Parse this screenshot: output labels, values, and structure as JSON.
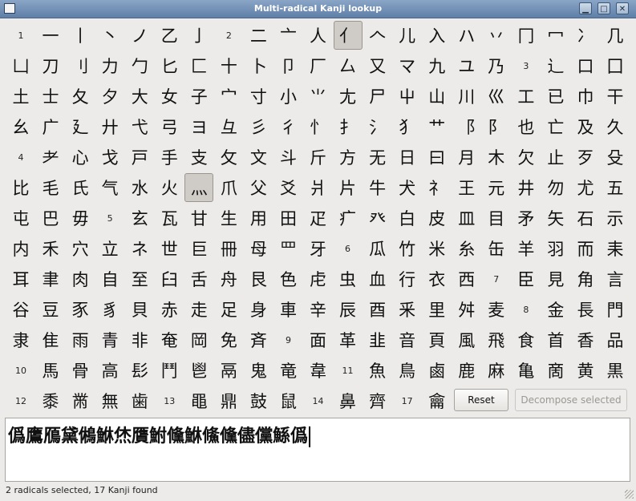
{
  "window": {
    "title": "Multi-radical Kanji lookup",
    "controls": [
      "▁",
      "□",
      "✕"
    ]
  },
  "radical_rows": [
    [
      {
        "t": "1",
        "s": true
      },
      {
        "t": "一"
      },
      {
        "t": "丨"
      },
      {
        "t": "丶"
      },
      {
        "t": "ノ"
      },
      {
        "t": "乙"
      },
      {
        "t": "亅"
      },
      {
        "t": "2",
        "s": true
      },
      {
        "t": "二"
      },
      {
        "t": "亠"
      },
      {
        "t": "人"
      },
      {
        "t": "亻",
        "sel": true
      },
      {
        "t": "𠆢"
      },
      {
        "t": "儿"
      },
      {
        "t": "入"
      },
      {
        "t": "ハ"
      },
      {
        "t": "丷"
      },
      {
        "t": "冂"
      },
      {
        "t": "冖"
      },
      {
        "t": "冫"
      },
      {
        "t": "几"
      }
    ],
    [
      {
        "t": "凵"
      },
      {
        "t": "刀"
      },
      {
        "t": "刂"
      },
      {
        "t": "力"
      },
      {
        "t": "勹"
      },
      {
        "t": "匕"
      },
      {
        "t": "匚"
      },
      {
        "t": "十"
      },
      {
        "t": "卜"
      },
      {
        "t": "卩"
      },
      {
        "t": "厂"
      },
      {
        "t": "厶"
      },
      {
        "t": "又"
      },
      {
        "t": "マ"
      },
      {
        "t": "九"
      },
      {
        "t": "ユ"
      },
      {
        "t": "乃"
      },
      {
        "t": "3",
        "s": true
      },
      {
        "t": "⻌"
      },
      {
        "t": "口"
      },
      {
        "t": "囗"
      }
    ],
    [
      {
        "t": "土"
      },
      {
        "t": "士"
      },
      {
        "t": "夂"
      },
      {
        "t": "夕"
      },
      {
        "t": "大"
      },
      {
        "t": "女"
      },
      {
        "t": "子"
      },
      {
        "t": "宀"
      },
      {
        "t": "寸"
      },
      {
        "t": "小"
      },
      {
        "t": "⺌"
      },
      {
        "t": "尢"
      },
      {
        "t": "尸"
      },
      {
        "t": "屮"
      },
      {
        "t": "山"
      },
      {
        "t": "川"
      },
      {
        "t": "巛"
      },
      {
        "t": "工"
      },
      {
        "t": "已"
      },
      {
        "t": "巾"
      },
      {
        "t": "干"
      }
    ],
    [
      {
        "t": "幺"
      },
      {
        "t": "广"
      },
      {
        "t": "廴"
      },
      {
        "t": "廾"
      },
      {
        "t": "弋"
      },
      {
        "t": "弓"
      },
      {
        "t": "ヨ"
      },
      {
        "t": "彑"
      },
      {
        "t": "彡"
      },
      {
        "t": "彳"
      },
      {
        "t": "忄"
      },
      {
        "t": "扌"
      },
      {
        "t": "氵"
      },
      {
        "t": "犭"
      },
      {
        "t": "艹"
      },
      {
        "t": "⻏"
      },
      {
        "t": "⻖"
      },
      {
        "t": "也"
      },
      {
        "t": "亡"
      },
      {
        "t": "及"
      },
      {
        "t": "久"
      }
    ],
    [
      {
        "t": "4",
        "s": true
      },
      {
        "t": "⺹"
      },
      {
        "t": "心"
      },
      {
        "t": "戈"
      },
      {
        "t": "戸"
      },
      {
        "t": "手"
      },
      {
        "t": "支"
      },
      {
        "t": "攵"
      },
      {
        "t": "文"
      },
      {
        "t": "斗"
      },
      {
        "t": "斤"
      },
      {
        "t": "方"
      },
      {
        "t": "无"
      },
      {
        "t": "日"
      },
      {
        "t": "曰"
      },
      {
        "t": "月"
      },
      {
        "t": "木"
      },
      {
        "t": "欠"
      },
      {
        "t": "止"
      },
      {
        "t": "歹"
      },
      {
        "t": "殳"
      }
    ],
    [
      {
        "t": "比"
      },
      {
        "t": "毛"
      },
      {
        "t": "氏"
      },
      {
        "t": "气"
      },
      {
        "t": "水"
      },
      {
        "t": "火"
      },
      {
        "t": "灬",
        "sel": true
      },
      {
        "t": "爪"
      },
      {
        "t": "父"
      },
      {
        "t": "爻"
      },
      {
        "t": "爿"
      },
      {
        "t": "片"
      },
      {
        "t": "牛"
      },
      {
        "t": "犬"
      },
      {
        "t": "礻"
      },
      {
        "t": "王"
      },
      {
        "t": "元"
      },
      {
        "t": "井"
      },
      {
        "t": "勿"
      },
      {
        "t": "尤"
      },
      {
        "t": "五"
      }
    ],
    [
      {
        "t": "屯"
      },
      {
        "t": "巴"
      },
      {
        "t": "毋"
      },
      {
        "t": "5",
        "s": true
      },
      {
        "t": "玄"
      },
      {
        "t": "瓦"
      },
      {
        "t": "甘"
      },
      {
        "t": "生"
      },
      {
        "t": "用"
      },
      {
        "t": "田"
      },
      {
        "t": "疋"
      },
      {
        "t": "疒"
      },
      {
        "t": "癶"
      },
      {
        "t": "白"
      },
      {
        "t": "皮"
      },
      {
        "t": "皿"
      },
      {
        "t": "目"
      },
      {
        "t": "矛"
      },
      {
        "t": "矢"
      },
      {
        "t": "石"
      },
      {
        "t": "示"
      }
    ],
    [
      {
        "t": "内"
      },
      {
        "t": "禾"
      },
      {
        "t": "穴"
      },
      {
        "t": "立"
      },
      {
        "t": "ネ"
      },
      {
        "t": "世"
      },
      {
        "t": "巨"
      },
      {
        "t": "冊"
      },
      {
        "t": "母"
      },
      {
        "t": "罒"
      },
      {
        "t": "牙"
      },
      {
        "t": "6",
        "s": true
      },
      {
        "t": "瓜"
      },
      {
        "t": "竹"
      },
      {
        "t": "米"
      },
      {
        "t": "糸"
      },
      {
        "t": "缶"
      },
      {
        "t": "羊"
      },
      {
        "t": "羽"
      },
      {
        "t": "而"
      },
      {
        "t": "耒"
      }
    ],
    [
      {
        "t": "耳"
      },
      {
        "t": "聿"
      },
      {
        "t": "肉"
      },
      {
        "t": "自"
      },
      {
        "t": "至"
      },
      {
        "t": "臼"
      },
      {
        "t": "舌"
      },
      {
        "t": "舟"
      },
      {
        "t": "艮"
      },
      {
        "t": "色"
      },
      {
        "t": "虍"
      },
      {
        "t": "虫"
      },
      {
        "t": "血"
      },
      {
        "t": "行"
      },
      {
        "t": "衣"
      },
      {
        "t": "西"
      },
      {
        "t": "7",
        "s": true
      },
      {
        "t": "臣"
      },
      {
        "t": "見"
      },
      {
        "t": "角"
      },
      {
        "t": "言"
      }
    ],
    [
      {
        "t": "谷"
      },
      {
        "t": "豆"
      },
      {
        "t": "豕"
      },
      {
        "t": "豸"
      },
      {
        "t": "貝"
      },
      {
        "t": "赤"
      },
      {
        "t": "走"
      },
      {
        "t": "足"
      },
      {
        "t": "身"
      },
      {
        "t": "車"
      },
      {
        "t": "辛"
      },
      {
        "t": "辰"
      },
      {
        "t": "酉"
      },
      {
        "t": "釆"
      },
      {
        "t": "里"
      },
      {
        "t": "舛"
      },
      {
        "t": "麦"
      },
      {
        "t": "8",
        "s": true
      },
      {
        "t": "金"
      },
      {
        "t": "長"
      },
      {
        "t": "門"
      }
    ],
    [
      {
        "t": "隶"
      },
      {
        "t": "隹"
      },
      {
        "t": "雨"
      },
      {
        "t": "青"
      },
      {
        "t": "非"
      },
      {
        "t": "奄"
      },
      {
        "t": "岡"
      },
      {
        "t": "免"
      },
      {
        "t": "斉"
      },
      {
        "t": "9",
        "s": true
      },
      {
        "t": "面"
      },
      {
        "t": "革"
      },
      {
        "t": "韭"
      },
      {
        "t": "音"
      },
      {
        "t": "頁"
      },
      {
        "t": "風"
      },
      {
        "t": "飛"
      },
      {
        "t": "食"
      },
      {
        "t": "首"
      },
      {
        "t": "香"
      },
      {
        "t": "品"
      }
    ],
    [
      {
        "t": "10",
        "s": true
      },
      {
        "t": "馬"
      },
      {
        "t": "骨"
      },
      {
        "t": "高"
      },
      {
        "t": "髟"
      },
      {
        "t": "鬥"
      },
      {
        "t": "鬯"
      },
      {
        "t": "鬲"
      },
      {
        "t": "鬼"
      },
      {
        "t": "竜"
      },
      {
        "t": "韋"
      },
      {
        "t": "11",
        "s": true
      },
      {
        "t": "魚"
      },
      {
        "t": "鳥"
      },
      {
        "t": "鹵"
      },
      {
        "t": "鹿"
      },
      {
        "t": "麻"
      },
      {
        "t": "亀"
      },
      {
        "t": "啇"
      },
      {
        "t": "黄"
      },
      {
        "t": "黒"
      }
    ],
    [
      {
        "t": "12",
        "s": true
      },
      {
        "t": "黍"
      },
      {
        "t": "黹"
      },
      {
        "t": "無"
      },
      {
        "t": "歯"
      },
      {
        "t": "13",
        "s": true
      },
      {
        "t": "黽"
      },
      {
        "t": "鼎"
      },
      {
        "t": "鼓"
      },
      {
        "t": "鼠"
      },
      {
        "t": "14",
        "s": true
      },
      {
        "t": "鼻"
      },
      {
        "t": "齊"
      },
      {
        "t": "17",
        "s": true
      },
      {
        "t": "龠"
      }
    ]
  ],
  "buttons": {
    "reset": "Reset",
    "decompose": "Decompose selected"
  },
  "results": {
    "kanji": "僞鷹鴈黛鵂鮴烋贋鮒儵鮴鯈儵儘儻鯀僞"
  },
  "status": {
    "text": "2 radicals selected, 17 Kanji found"
  }
}
